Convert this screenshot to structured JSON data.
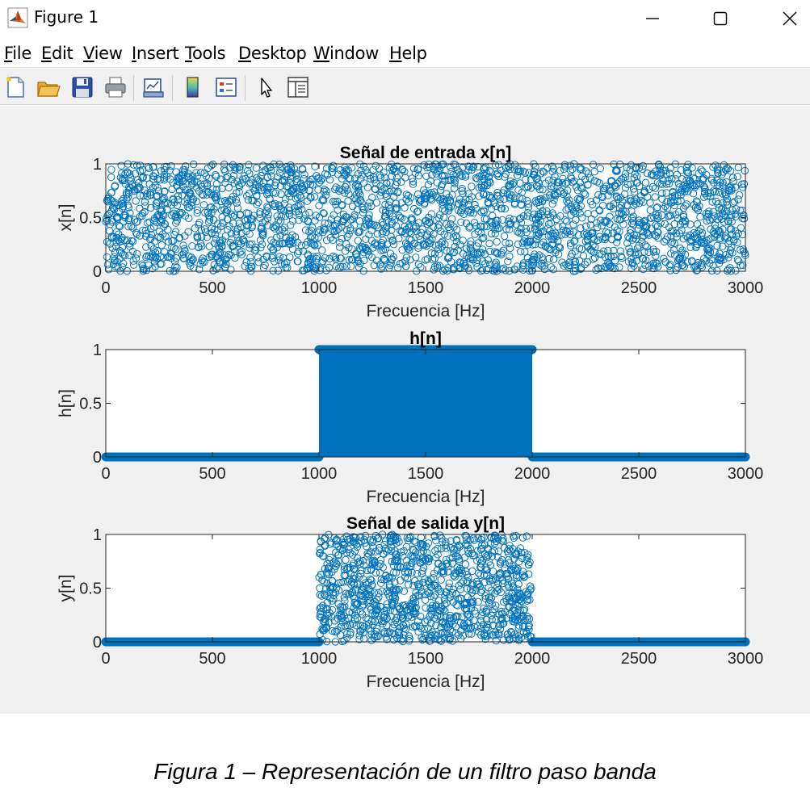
{
  "window": {
    "title": "Figure 1",
    "controls": [
      "minimize-icon",
      "maximize-icon",
      "close-icon"
    ]
  },
  "menu": {
    "items": [
      {
        "first": "F",
        "rest": "ile"
      },
      {
        "first": "E",
        "rest": "dit"
      },
      {
        "first": "V",
        "rest": "iew"
      },
      {
        "first": "I",
        "rest": "nsert"
      },
      {
        "first": "T",
        "rest": "ools"
      },
      {
        "first": "D",
        "rest": "esktop"
      },
      {
        "first": "W",
        "rest": "indow"
      },
      {
        "first": "H",
        "rest": "elp"
      }
    ]
  },
  "toolbar": {
    "icons": [
      "new-figure-icon",
      "open-file-icon",
      "save-icon",
      "print-icon",
      "link-plot-icon",
      "colorbar-icon",
      "legend-icon",
      "edit-plot-icon",
      "property-inspector-icon"
    ]
  },
  "colors": {
    "series": "#0072BD",
    "figure_bg": "#f0f0f0"
  },
  "chart_data": [
    {
      "type": "scatter",
      "title": "Señal de entrada x[n]",
      "xlabel": "Frecuencia [Hz]",
      "ylabel": "x[n]",
      "xlim": [
        0,
        3000
      ],
      "ylim": [
        0,
        1
      ],
      "xticks": [
        "0",
        "500",
        "1000",
        "1500",
        "2000",
        "2500",
        "3000"
      ],
      "yticks": [
        "0",
        "0.5",
        "1"
      ],
      "marker": "circle",
      "description_values": {
        "x_range": [
          0,
          3000
        ],
        "y_range": [
          0,
          1
        ],
        "distribution": "uniform random"
      }
    },
    {
      "type": "scatter",
      "title": "h[n]",
      "xlabel": "Frecuencia [Hz]",
      "ylabel": "h[n]",
      "xlim": [
        0,
        3000
      ],
      "ylim": [
        0,
        1
      ],
      "xticks": [
        "0",
        "500",
        "1000",
        "1500",
        "2000",
        "2500",
        "3000"
      ],
      "yticks": [
        "0",
        "0.5",
        "1"
      ],
      "marker": "filled-circle",
      "segments": [
        {
          "x": [
            0,
            1000
          ],
          "y": 0
        },
        {
          "x": [
            1000,
            2000
          ],
          "y": 1
        },
        {
          "x": [
            2000,
            3000
          ],
          "y": 0
        }
      ]
    },
    {
      "type": "scatter",
      "title": "Señal de salida y[n]",
      "xlabel": "Frecuencia [Hz]",
      "ylabel": "y[n]",
      "xlim": [
        0,
        3000
      ],
      "ylim": [
        0,
        1
      ],
      "xticks": [
        "0",
        "500",
        "1000",
        "1500",
        "2000",
        "2500",
        "3000"
      ],
      "yticks": [
        "0",
        "0.5",
        "1"
      ],
      "marker": "circle",
      "segments": [
        {
          "x": [
            0,
            1000
          ],
          "y": 0
        },
        {
          "x": [
            1000,
            2000
          ],
          "y": "random 0-1"
        },
        {
          "x": [
            2000,
            3000
          ],
          "y": 0
        }
      ]
    }
  ],
  "caption": "Figura 1 – Representación de un filtro paso banda"
}
